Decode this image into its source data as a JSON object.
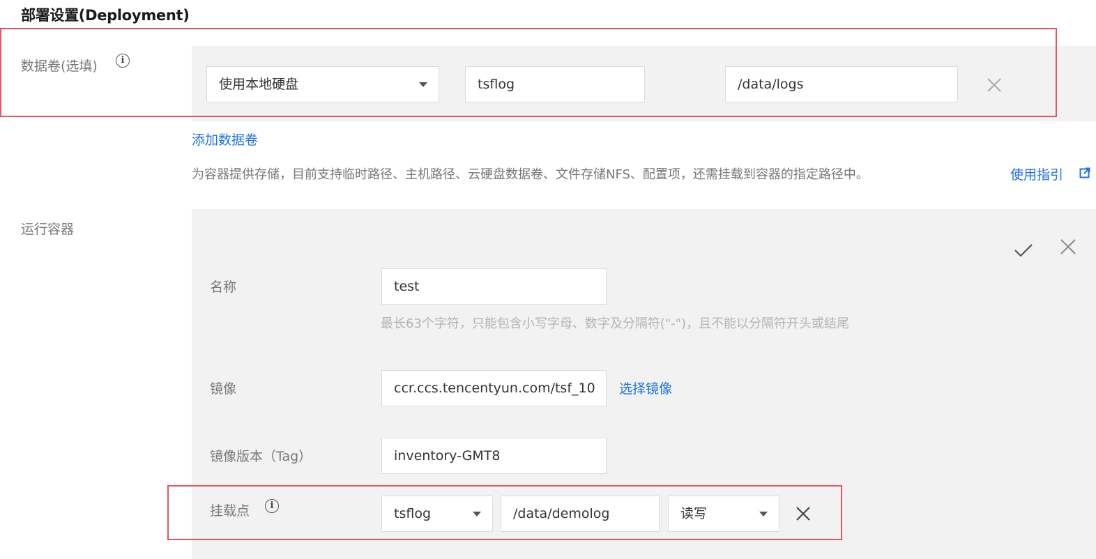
{
  "page": {
    "title": "部署设置(Deployment)"
  },
  "volume": {
    "label": "数据卷(选填)",
    "type_select": "使用本地硬盘",
    "name_value": "tsflog",
    "path_value": "/data/logs",
    "add_link": "添加数据卷",
    "description": "为容器提供存储，目前支持临时路径、主机路径、云硬盘数据卷、文件存储NFS、配置项，还需挂载到容器的指定路径中。",
    "guide_link": "使用指引"
  },
  "container": {
    "section_label": "运行容器",
    "name_label": "名称",
    "name_value": "test",
    "name_hint": "最长63个字符，只能包含小写字母、数字及分隔符(\"-\")，且不能以分隔符开头或结尾",
    "image_label": "镜像",
    "image_value": "ccr.ccs.tencentyun.com/tsf_10",
    "select_image_link": "选择镜像",
    "tag_label": "镜像版本（Tag）",
    "tag_value": "inventory-GMT8",
    "mount_label": "挂载点",
    "mount_volume": "tsflog",
    "mount_path": "/data/demolog",
    "mount_mode": "读写"
  },
  "icons": {
    "info": "info-circle-icon",
    "close": "close-icon",
    "check": "check-icon",
    "external": "external-link-icon",
    "dropdown": "chevron-down-icon"
  },
  "colors": {
    "link": "#1f72e6",
    "highlight": "#e8545c",
    "panel_bg": "#f2f2f2"
  }
}
